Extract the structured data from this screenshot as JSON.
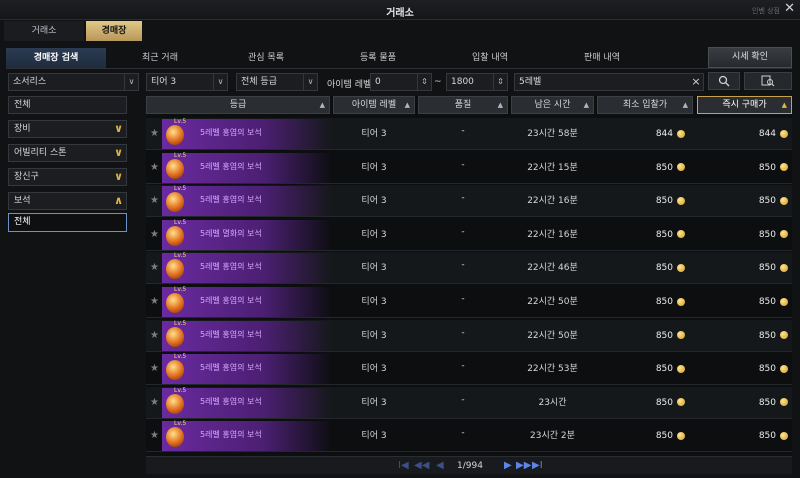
{
  "window": {
    "title": "거래소",
    "shop_link": "인벤 상점",
    "close_icon": "close-icon"
  },
  "top_tabs": [
    {
      "label": "거래소"
    },
    {
      "label": "경매장"
    }
  ],
  "sub_tabs": [
    {
      "label": "경매장 검색"
    },
    {
      "label": "최근 거래"
    },
    {
      "label": "관심 목록"
    },
    {
      "label": "등록 물품"
    },
    {
      "label": "입찰 내역"
    },
    {
      "label": "판매 내역"
    }
  ],
  "market_button": "시세 확인",
  "filters": {
    "category": "소서리스",
    "tier": "티어 3",
    "grade": "전체 등급",
    "level_label": "아이템 레벨",
    "level_min": "0",
    "level_max": "1800",
    "search_value": "5레벨",
    "clear_icon": "×",
    "search_icon": "search-icon",
    "detail_icon": "detail-search-icon"
  },
  "categories": [
    {
      "label": "전체"
    },
    {
      "label": "장비",
      "chev": "∨"
    },
    {
      "label": "어빌리티 스톤",
      "chev": "∨"
    },
    {
      "label": "장신구",
      "chev": "∨"
    },
    {
      "label": "보석",
      "chev": "∧"
    },
    {
      "label": "전체"
    }
  ],
  "columns": [
    "등급",
    "아이템 레벨",
    "품질",
    "남은 시간",
    "최소 입찰가",
    "즉시 구매가"
  ],
  "sort_glyph": "▲",
  "rows": [
    {
      "lv": "Lv.5",
      "name": "5레벨 홍염의 보석",
      "tier": "티어 3",
      "quality": "-",
      "time": "23시간 58분",
      "bid": "844",
      "buy": "844"
    },
    {
      "lv": "Lv.5",
      "name": "5레벨 홍염의 보석",
      "tier": "티어 3",
      "quality": "-",
      "time": "22시간 15분",
      "bid": "850",
      "buy": "850"
    },
    {
      "lv": "Lv.5",
      "name": "5레벨 홍염의 보석",
      "tier": "티어 3",
      "quality": "-",
      "time": "22시간 16분",
      "bid": "850",
      "buy": "850"
    },
    {
      "lv": "Lv.5",
      "name": "5레벨 멸화의 보석",
      "tier": "티어 3",
      "quality": "-",
      "time": "22시간 16분",
      "bid": "850",
      "buy": "850"
    },
    {
      "lv": "Lv.5",
      "name": "5레벨 홍염의 보석",
      "tier": "티어 3",
      "quality": "-",
      "time": "22시간 46분",
      "bid": "850",
      "buy": "850"
    },
    {
      "lv": "Lv.5",
      "name": "5레벨 홍염의 보석",
      "tier": "티어 3",
      "quality": "-",
      "time": "22시간 50분",
      "bid": "850",
      "buy": "850"
    },
    {
      "lv": "Lv.5",
      "name": "5레벨 홍염의 보석",
      "tier": "티어 3",
      "quality": "-",
      "time": "22시간 50분",
      "bid": "850",
      "buy": "850"
    },
    {
      "lv": "Lv.5",
      "name": "5레벨 홍염의 보석",
      "tier": "티어 3",
      "quality": "-",
      "time": "22시간 53분",
      "bid": "850",
      "buy": "850"
    },
    {
      "lv": "Lv.5",
      "name": "5레벨 홍염의 보석",
      "tier": "티어 3",
      "quality": "-",
      "time": "23시간",
      "bid": "850",
      "buy": "850"
    },
    {
      "lv": "Lv.5",
      "name": "5레벨 홍염의 보석",
      "tier": "티어 3",
      "quality": "-",
      "time": "23시간 2분",
      "bid": "850",
      "buy": "850"
    }
  ],
  "pager": {
    "first": "I◀",
    "prev": "◀◀",
    "back": "◀",
    "page_info": "1/994",
    "next": "▶",
    "fwd": "▶▶",
    "last": "▶I"
  },
  "colors": {
    "accent_gold": "#c9a24a",
    "tab_active_blue": "#2b3b52",
    "item_purple": "#6a2aa0"
  }
}
